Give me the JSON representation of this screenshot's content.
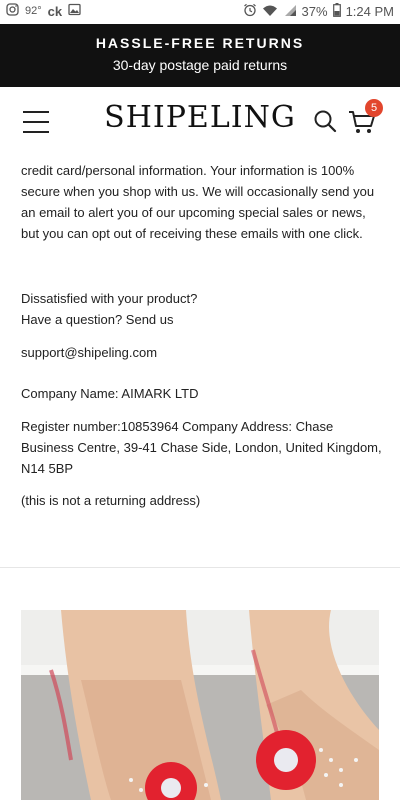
{
  "status_bar": {
    "temperature": "92°",
    "carrier": "ck",
    "battery": "37%",
    "time": "1:24 PM",
    "icons": [
      "instagram-icon",
      "image-icon",
      "alarm-icon",
      "wifi-icon",
      "signal-icon",
      "battery-icon"
    ]
  },
  "promo": {
    "title": "HASSLE-FREE RETURNS",
    "subtitle": "30-day postage paid returns"
  },
  "header": {
    "logo": "SHIPELING",
    "cart_count": "5",
    "accent_color": "#e2462d"
  },
  "content": {
    "paragraph_1": "credit card/personal information. Your information is 100% secure when you shop with us. We will occasionally send you an email to alert you of our upcoming special sales or news, but you can opt out of receiving these emails with one click.",
    "dissatisfied": "Dissatisfied with your product?",
    "question": "Have a question? Send us",
    "email": "support@shipeling.com",
    "company_name": "Company Name: AIMARK LTD",
    "register": "Register number:10853964 Company Address: Chase Business Centre, 39-41 Chase Side, London, United Kingdom, N14 5BP",
    "note": "(this is not a returning address)"
  },
  "product": {
    "image_icon": "shoe-photo"
  }
}
